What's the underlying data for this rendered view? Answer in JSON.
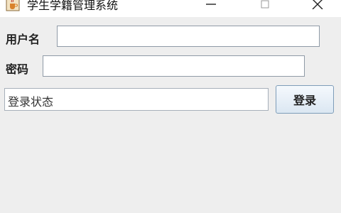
{
  "window": {
    "title": "学生学籍管理系统",
    "minimize_glyph": "—",
    "close_glyph": "✕"
  },
  "form": {
    "username_label": "用户名",
    "username_value": "",
    "password_label": "密码",
    "password_value": "",
    "status_text": "登录状态",
    "login_label": "登录"
  },
  "icons": {
    "app": "java-cup-icon",
    "minimize": "minimize-icon",
    "maximize": "maximize-icon",
    "close": "close-icon"
  }
}
